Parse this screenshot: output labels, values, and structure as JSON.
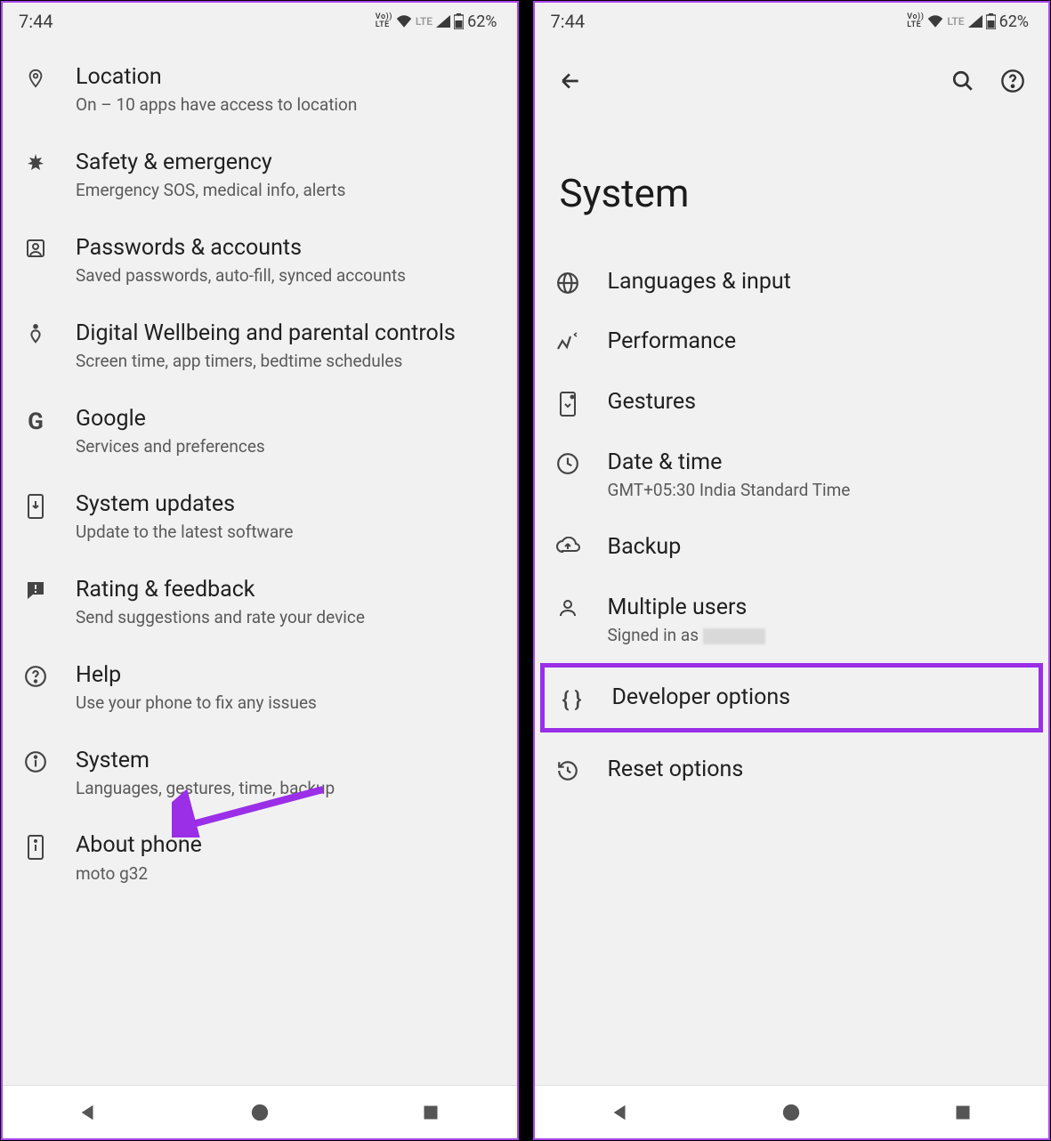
{
  "statusbar": {
    "time": "7:44",
    "battery": "62%"
  },
  "left": {
    "items": [
      {
        "title": "Location",
        "sub": "On – 10 apps have access to location"
      },
      {
        "title": "Safety & emergency",
        "sub": "Emergency SOS, medical info, alerts"
      },
      {
        "title": "Passwords & accounts",
        "sub": "Saved passwords, auto-fill, synced accounts"
      },
      {
        "title": "Digital Wellbeing and parental controls",
        "sub": "Screen time, app timers, bedtime schedules"
      },
      {
        "title": "Google",
        "sub": "Services and preferences"
      },
      {
        "title": "System updates",
        "sub": "Update to the latest software"
      },
      {
        "title": "Rating & feedback",
        "sub": "Send suggestions and rate your device"
      },
      {
        "title": "Help",
        "sub": "Use your phone to fix any issues"
      },
      {
        "title": "System",
        "sub": "Languages, gestures, time, backup"
      },
      {
        "title": "About phone",
        "sub": "moto g32"
      }
    ]
  },
  "right": {
    "title": "System",
    "items": [
      {
        "title": "Languages & input"
      },
      {
        "title": "Performance"
      },
      {
        "title": "Gestures"
      },
      {
        "title": "Date & time",
        "sub": "GMT+05:30 India Standard Time"
      },
      {
        "title": "Backup"
      },
      {
        "title": "Multiple users",
        "sub": "Signed in as "
      },
      {
        "title": "Developer options"
      },
      {
        "title": "Reset options"
      }
    ]
  }
}
